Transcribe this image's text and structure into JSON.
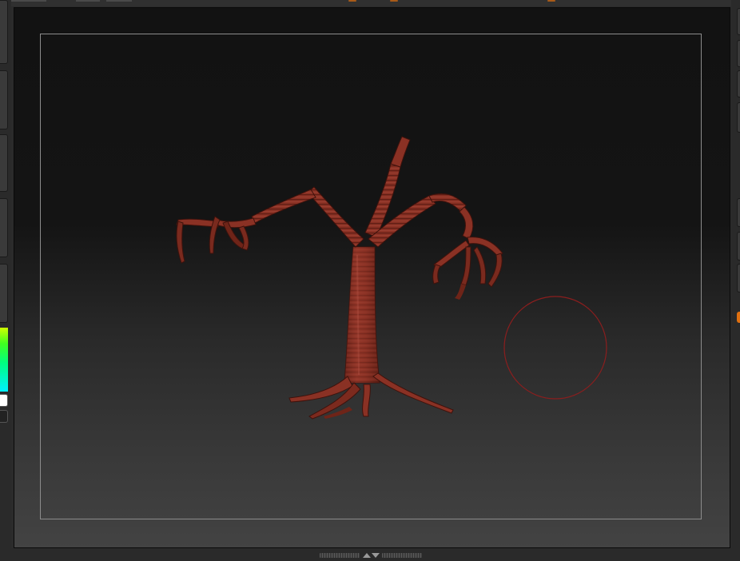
{
  "app": {
    "name": "",
    "colors": {
      "viewport_top": "#121212",
      "viewport_bottom": "#434343",
      "document_frame": "#8c8c8c",
      "model": "#8a3124",
      "brush_cursor": "#8b1e1e",
      "ui_accent": "#e07010"
    }
  },
  "left_shelf": {
    "buttons": [
      "tool-button",
      "tool-button",
      "tool-button",
      "tool-button",
      "tool-button"
    ],
    "color_picker": "color-gradient",
    "main_color": "#ffffff",
    "secondary_color": "#222222"
  },
  "right_shelf": {
    "buttons": [
      "tool-button",
      "tool-button",
      "tool-button",
      "tool-button",
      "tool-button",
      "tool-button",
      "tool-button"
    ],
    "accent": "#e07010"
  },
  "viewport": {
    "model": "tree-creature-mesh",
    "brush_cursor": "circle-brush-cursor",
    "frame": "document-boundary"
  },
  "bottom_shelf": {
    "toggle_icon": "expand-collapse-arrows-icon"
  }
}
